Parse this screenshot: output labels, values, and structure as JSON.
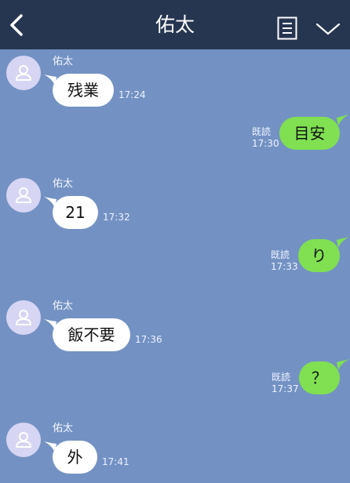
{
  "header": {
    "title": "佑太",
    "back_icon": "chevron-left-icon",
    "memo_icon": "note-icon",
    "menu_icon": "chevron-down-icon"
  },
  "colors": {
    "header_bg": "#263651",
    "chat_bg": "#7392c3",
    "incoming_bubble": "#ffffff",
    "outgoing_bubble": "#80e051",
    "avatar_bg": "#d6d5f3"
  },
  "messages": [
    {
      "direction": "in",
      "sender": "佑太",
      "text": "残業",
      "time": "17:24"
    },
    {
      "direction": "out",
      "read": "既読",
      "text": "目安",
      "time": "17:30"
    },
    {
      "direction": "in",
      "sender": "佑太",
      "text": "21",
      "time": "17:32"
    },
    {
      "direction": "out",
      "read": "既読",
      "text": "り",
      "time": "17:33"
    },
    {
      "direction": "in",
      "sender": "佑太",
      "text": "飯不要",
      "time": "17:36"
    },
    {
      "direction": "out",
      "read": "既読",
      "text": "？",
      "time": "17:37"
    },
    {
      "direction": "in",
      "sender": "佑太",
      "text": "外",
      "time": "17:41"
    }
  ]
}
